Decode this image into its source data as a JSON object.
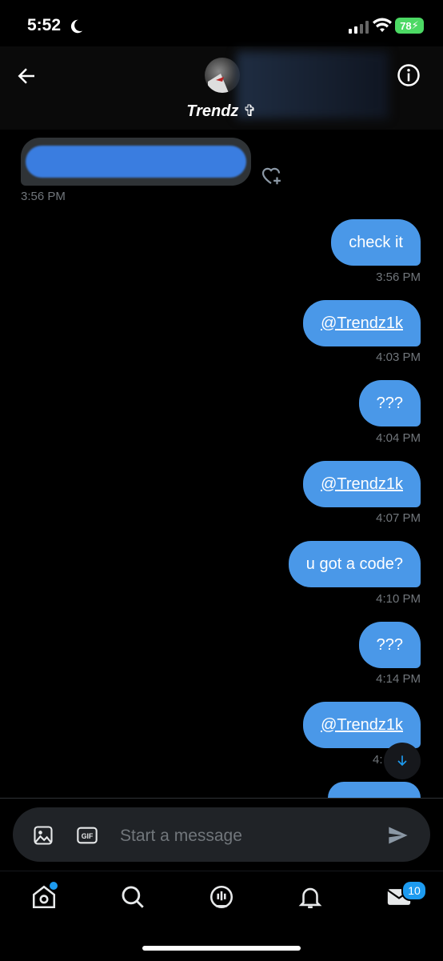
{
  "status_bar": {
    "time": "5:52",
    "battery": "78"
  },
  "header": {
    "contact_name": "Trendz ✞"
  },
  "messages": [
    {
      "direction": "in",
      "text": "",
      "time": "3:56 PM"
    },
    {
      "direction": "out",
      "text": "check it",
      "time": "3:56 PM",
      "link": false
    },
    {
      "direction": "out",
      "text": "@Trendz1k",
      "time": "4:03 PM",
      "link": true
    },
    {
      "direction": "out",
      "text": "???",
      "time": "4:04 PM",
      "link": false
    },
    {
      "direction": "out",
      "text": "@Trendz1k",
      "time": "4:07 PM",
      "link": true
    },
    {
      "direction": "out",
      "text": "u got a code?",
      "time": "4:10 PM",
      "link": false
    },
    {
      "direction": "out",
      "text": "???",
      "time": "4:14 PM",
      "link": false
    },
    {
      "direction": "out",
      "text": "@Trendz1k",
      "time": "4:",
      "link": true
    }
  ],
  "composer": {
    "placeholder": "Start a message"
  },
  "bottom_nav": {
    "messages_badge": "10"
  },
  "colors": {
    "accent": "#1d9bf0",
    "bubble_out": "#4a98e8",
    "bubble_in": "#2f3336"
  }
}
